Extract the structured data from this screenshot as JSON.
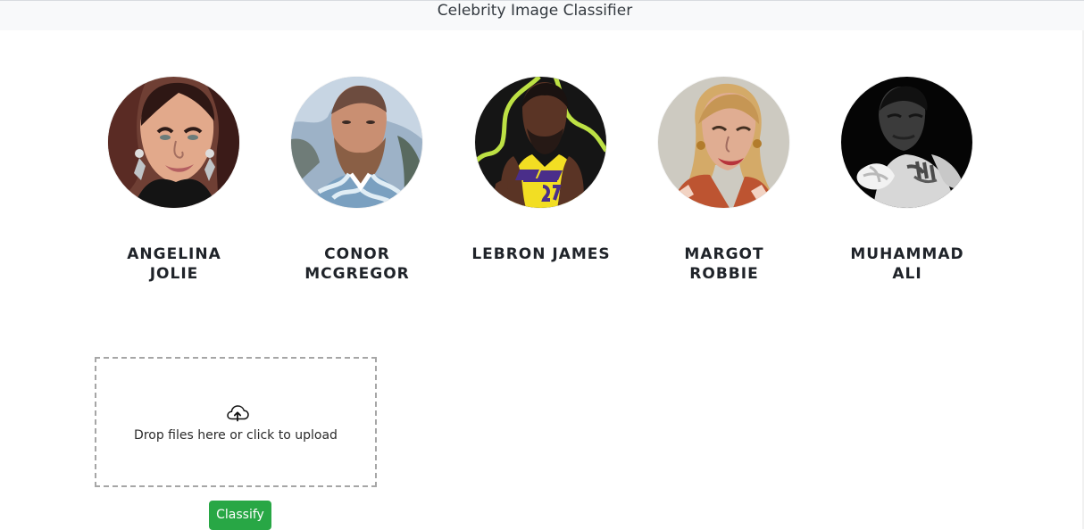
{
  "app": {
    "title": "Celebrity Image Classifier"
  },
  "celebrities": [
    {
      "name_line1": "ANGELINA",
      "name_line2": "JOLIE",
      "image_icon": "angelina-jolie-photo"
    },
    {
      "name_line1": "CONOR",
      "name_line2": "MCGREGOR",
      "image_icon": "conor-mcgregor-photo"
    },
    {
      "name_line1": "LEBRON JAMES",
      "name_line2": "",
      "image_icon": "lebron-james-photo"
    },
    {
      "name_line1": "MARGOT",
      "name_line2": "ROBBIE",
      "image_icon": "margot-robbie-photo"
    },
    {
      "name_line1": "MUHAMMAD",
      "name_line2": "ALI",
      "image_icon": "muhammad-ali-photo"
    }
  ],
  "upload": {
    "icon": "cloud-upload-icon",
    "text": "Drop files here or click to upload"
  },
  "actions": {
    "classify_label": "Classify"
  },
  "colors": {
    "topbar": "#f8f9fa",
    "success": "#28a745",
    "dropzone_border": "#a6a6a6"
  }
}
